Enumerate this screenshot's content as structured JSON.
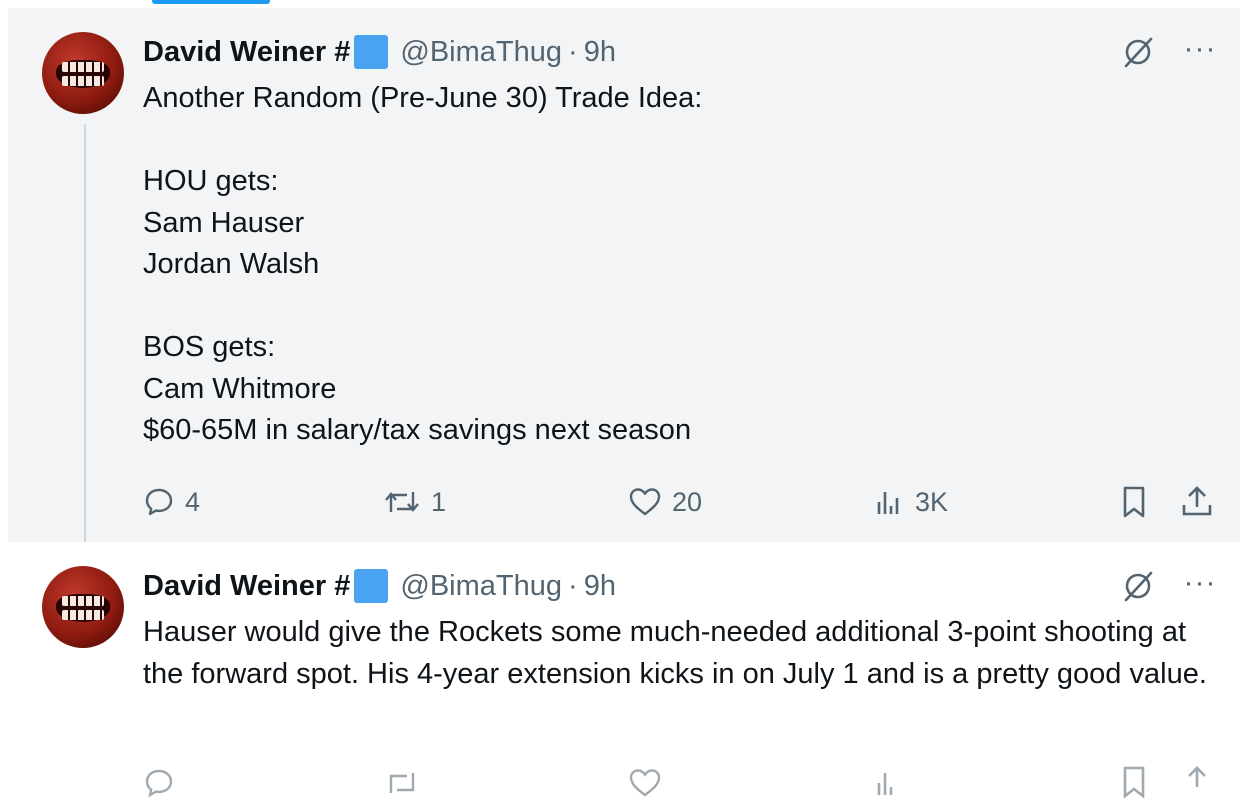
{
  "tweets": [
    {
      "author_name": "David Weiner #",
      "handle": "@BimaThug",
      "separator": "·",
      "time": "9h",
      "text": "Another Random (Pre-June 30) Trade Idea:\n\nHOU gets:\nSam Hauser\nJordan Walsh\n\nBOS gets:\nCam Whitmore\n$60-65M in salary/tax savings next season",
      "replies": "4",
      "reposts": "1",
      "likes": "20",
      "views": "3K"
    },
    {
      "author_name": "David Weiner #",
      "handle": "@BimaThug",
      "separator": "·",
      "time": "9h",
      "text": "Hauser would give the Rockets some much-needed additional 3-point shooting at the forward spot. His 4-year extension kicks in on July 1 and is a pretty good value."
    }
  ],
  "icons": {
    "reply": "reply-icon",
    "repost": "repost-icon",
    "like": "heart-icon",
    "views": "views-icon",
    "bookmark": "bookmark-icon",
    "share": "share-icon",
    "grok": "grok-icon",
    "more": "more-icon"
  },
  "colors": {
    "accent": "#1d9bf0",
    "verified_badge": "#4aa3f0",
    "text_primary": "#0f1419",
    "text_secondary": "#536471",
    "highlight_bg": "#f3f4f6"
  }
}
